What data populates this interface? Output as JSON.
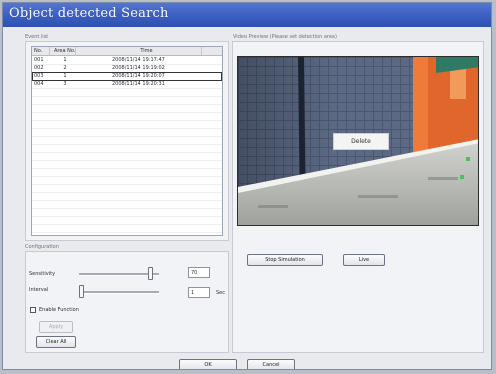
{
  "window": {
    "title": "Object detected Search"
  },
  "event_list": {
    "group_label": "Event list",
    "columns": {
      "no": "No.",
      "area": "Area No.",
      "time": "Time"
    },
    "rows": [
      {
        "no": "001",
        "area": "1",
        "time": "2008/11/14 19:17:47"
      },
      {
        "no": "002",
        "area": "2",
        "time": "2008/11/14 19:19:02"
      },
      {
        "no": "003",
        "area": "1",
        "time": "2008/11/14 19:20:07"
      },
      {
        "no": "004",
        "area": "3",
        "time": "2008/11/14 19:20:31"
      }
    ]
  },
  "video": {
    "group_label": "Video Preview (Please set detection area)",
    "popup_label": "Delete"
  },
  "configuration": {
    "group_label": "Configuration",
    "sensitivity_label": "Sensitivity",
    "sensitivity_value": "70",
    "sensitivity_level": 0.92,
    "interval_label": "Interval",
    "interval_value": "1",
    "interval_level": 0.0,
    "interval_unit": "Sec",
    "enable_label": "Enable Function",
    "enable_checked": false,
    "apply_label": "Apply",
    "clear_label": "Clear All"
  },
  "preview_controls": {
    "stop_label": "Stop Simulation",
    "live_label": "Live"
  },
  "footer": {
    "ok_label": "OK",
    "cancel_label": "Cancel"
  },
  "colors": {
    "titlebar": "#3a5ec2",
    "dialog_bg": "#e9eaee",
    "video_wall": "#52607a",
    "video_orange": "#e0662c"
  }
}
